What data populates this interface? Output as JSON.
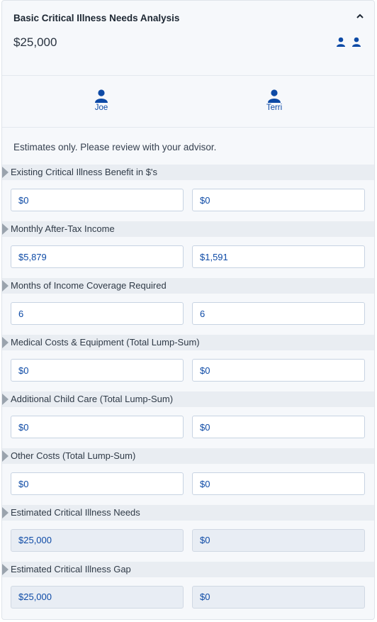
{
  "header": {
    "title": "Basic Critical Illness Needs Analysis",
    "amount": "$25,000",
    "collapse_icon": "chevron-up-icon",
    "people_icon": "two-persons-icon"
  },
  "persons": [
    {
      "name": "Joe",
      "icon": "person-icon"
    },
    {
      "name": "Terri",
      "icon": "person-icon"
    }
  ],
  "note": "Estimates only. Please review with your advisor.",
  "colors": {
    "accent": "#0d4aa6",
    "row_label_bg": "#e9edf2",
    "readonly_bg": "#e8edf4"
  },
  "rows": [
    {
      "label": "Existing Critical Illness Benefit in $'s",
      "joe": "$0",
      "terri": "$0",
      "readonly": false
    },
    {
      "label": "Monthly After-Tax Income",
      "joe": "$5,879",
      "terri": "$1,591",
      "readonly": false
    },
    {
      "label": "Months of Income Coverage Required",
      "joe": "6",
      "terri": "6",
      "readonly": false
    },
    {
      "label": "Medical Costs & Equipment (Total Lump-Sum)",
      "joe": "$0",
      "terri": "$0",
      "readonly": false
    },
    {
      "label": "Additional Child Care (Total Lump-Sum)",
      "joe": "$0",
      "terri": "$0",
      "readonly": false
    },
    {
      "label": "Other Costs (Total Lump-Sum)",
      "joe": "$0",
      "terri": "$0",
      "readonly": false
    },
    {
      "label": "Estimated Critical Illness Needs",
      "joe": "$25,000",
      "terri": "$0",
      "readonly": true
    },
    {
      "label": "Estimated Critical Illness Gap",
      "joe": "$25,000",
      "terri": "$0",
      "readonly": true
    }
  ]
}
